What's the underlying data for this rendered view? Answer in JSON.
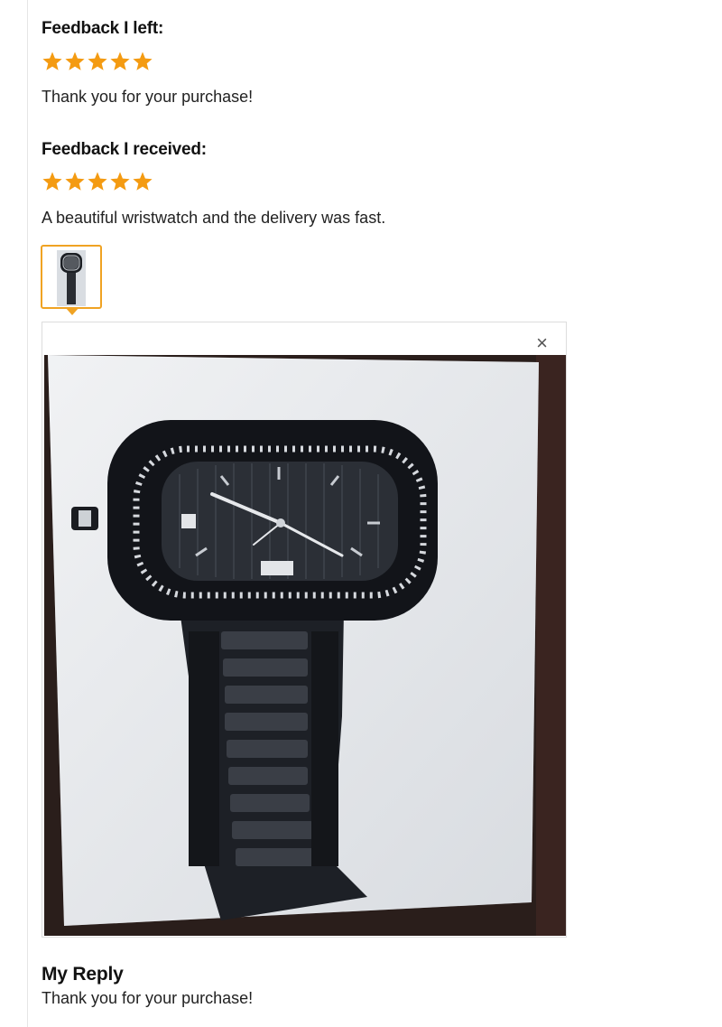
{
  "feedback_left": {
    "heading": "Feedback I left:",
    "rating": 5,
    "text": "Thank you for your purchase!"
  },
  "feedback_received": {
    "heading": "Feedback I received:",
    "rating": 5,
    "text": "A beautiful wristwatch and the delivery was fast."
  },
  "viewer": {
    "close_label": "×"
  },
  "reply": {
    "heading": "My Reply",
    "text": "Thank you for your purchase!"
  },
  "colors": {
    "star": "#f49b12",
    "thumb_border": "#f0a323"
  }
}
